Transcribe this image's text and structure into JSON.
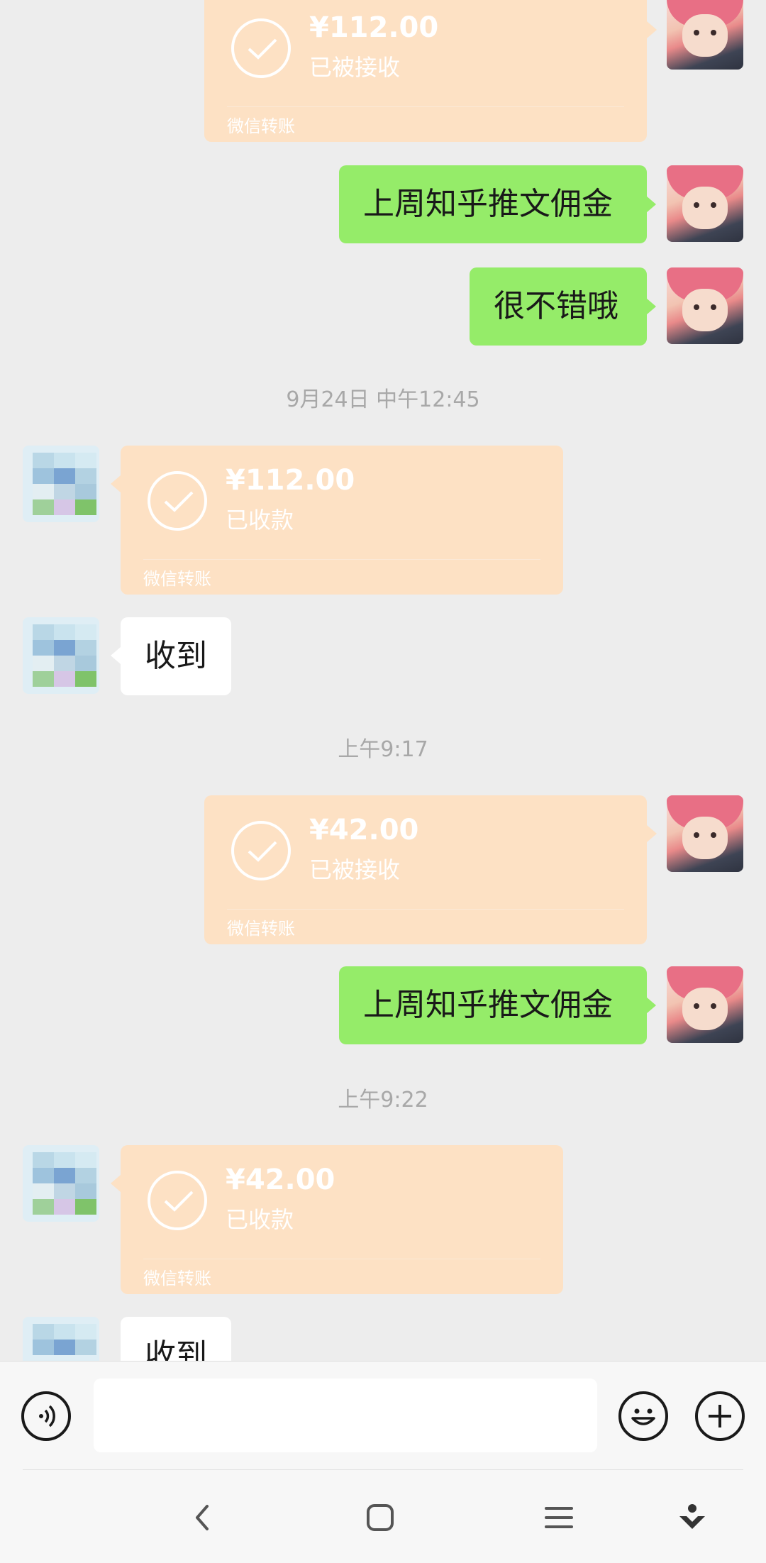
{
  "messages": {
    "transfer_top": {
      "amount": "¥112.00",
      "status": "已被接收",
      "brand": "微信转账"
    },
    "msg_commission_1": "上周知乎推文佣金",
    "msg_good": "很不错哦",
    "time_1": "9月24日 中午12:45",
    "transfer_recv_1": {
      "amount": "¥112.00",
      "status": "已收款",
      "brand": "微信转账"
    },
    "msg_received_1": "收到",
    "time_2": "上午9:17",
    "transfer_sent_2": {
      "amount": "¥42.00",
      "status": "已被接收",
      "brand": "微信转账"
    },
    "msg_commission_2": "上周知乎推文佣金",
    "time_3": "上午9:22",
    "transfer_recv_2": {
      "amount": "¥42.00",
      "status": "已收款",
      "brand": "微信转账"
    },
    "msg_received_2": "收到"
  },
  "colors": {
    "background": "#ededed",
    "my_bubble": "#95ec69",
    "their_bubble": "#ffffff",
    "transfer_card": "#fde1c4"
  },
  "icons": {
    "voice": "voice-icon",
    "emoji": "emoji-icon",
    "more": "plus-icon",
    "nav_back": "back-icon",
    "nav_home": "home-icon",
    "nav_menu": "menu-icon",
    "nav_assist": "assist-icon"
  }
}
